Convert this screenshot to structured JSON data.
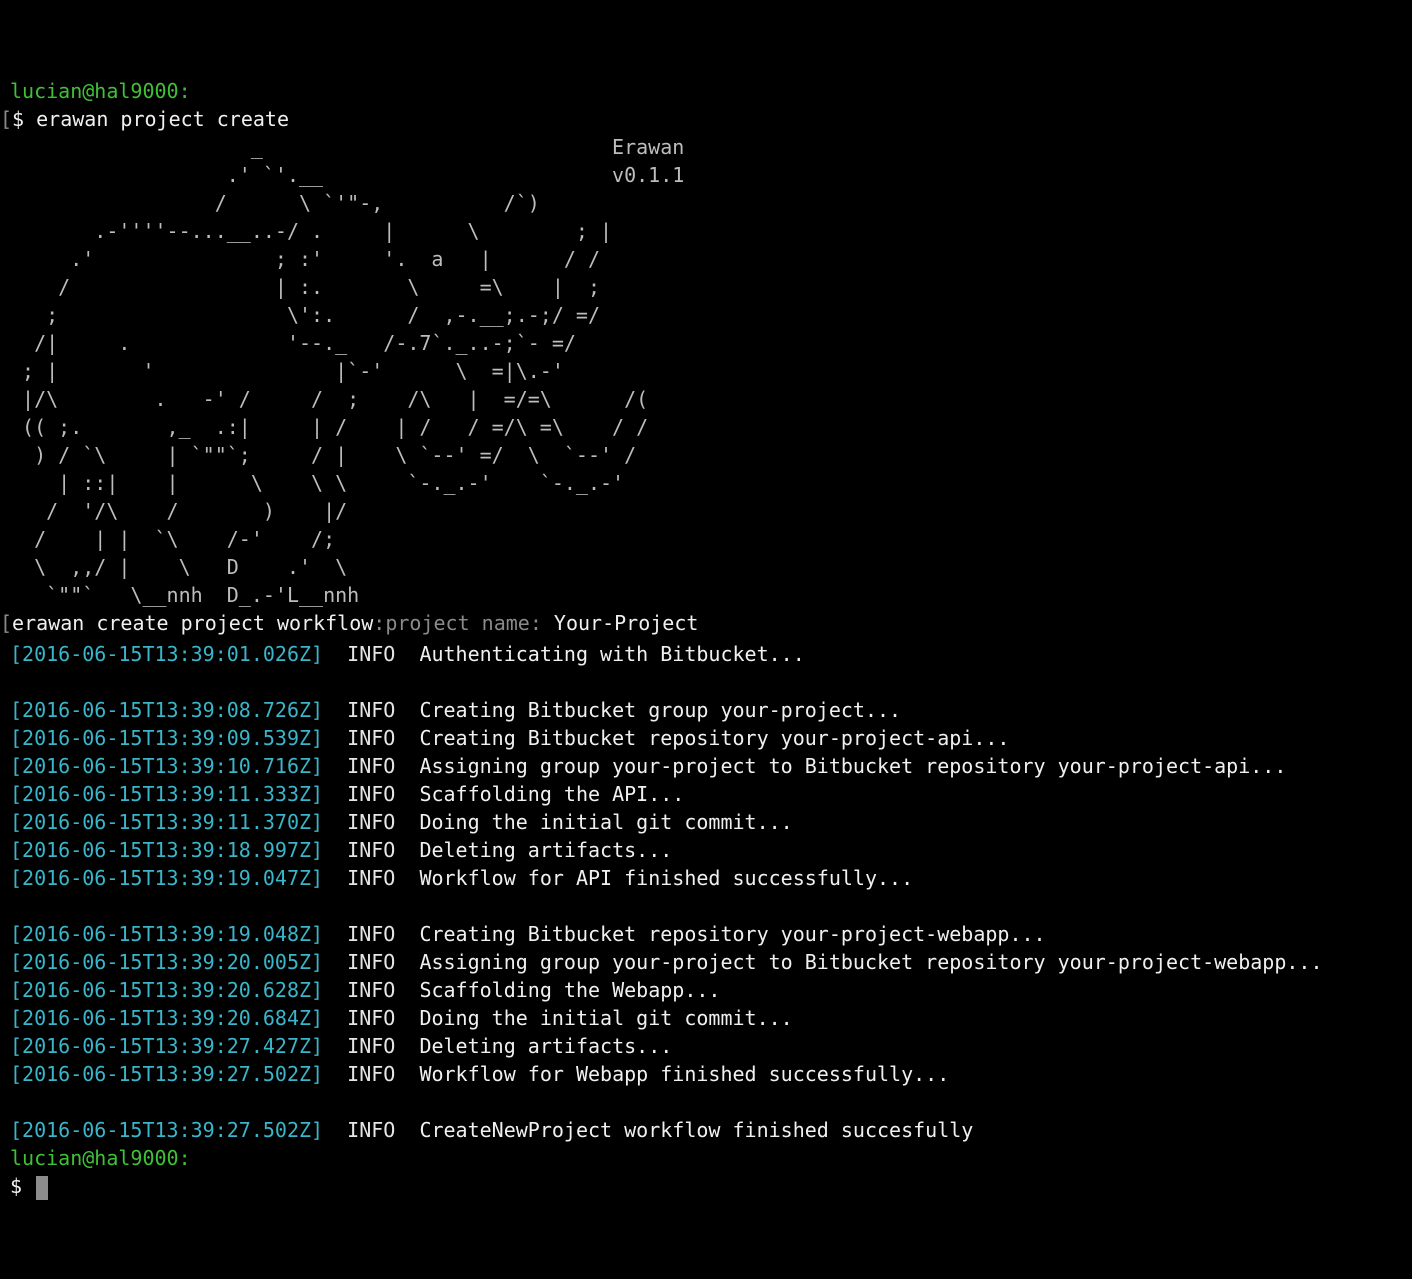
{
  "prompt1": {
    "user_host": "lucian@hal9000:",
    "bracket": "[",
    "symbol": "$ ",
    "command": "erawan project create"
  },
  "art": {
    "lines": [
      "                    _                             Erawan",
      "                  .' `'.__                        v0.1.1",
      "                 /      \\ `'\"-,          /`)",
      "       .-''''--...__..-/ .     |      \\        ; |",
      "     .'               ; :'     '.  a   |      / /",
      "    /                 | :.       \\     =\\    |  ;",
      "   ;                   \\':.      /  ,-.__;.-;/ =/",
      "  /|     .             '--._   /-.7`._..-;`- =/",
      " ; |       '               |`-'      \\  =|\\.-'",
      " |/\\        .   -' /     /  ;    /\\   |  =/=\\      /(",
      " (( ;.       ,_  .:|     | /    | /   / =/\\ =\\    / /",
      "  ) / `\\     | `\"\"`;     / |    \\ `--' =/  \\  `--' /",
      "    | ::|    |      \\    \\ \\     `-._.-'    `-._.-'",
      "   /  '/\\    /       )    |/",
      "  /    | |  `\\    /-'    /;",
      "  \\  ,,/ |    \\   D    .'  \\",
      "   `\"\"`   \\__nnh  D_.-'L__nnh"
    ]
  },
  "workflow_prompt": {
    "bracket": "[",
    "label": "erawan create project workflow",
    "colon": ":",
    "question": "project name: ",
    "answer": "Your-Project"
  },
  "logs": [
    {
      "ts": "[2016-06-15T13:39:01.026Z]",
      "level": "INFO",
      "msg": "Authenticating with Bitbucket..."
    },
    null,
    {
      "ts": "[2016-06-15T13:39:08.726Z]",
      "level": "INFO",
      "msg": "Creating Bitbucket group your-project..."
    },
    {
      "ts": "[2016-06-15T13:39:09.539Z]",
      "level": "INFO",
      "msg": "Creating Bitbucket repository your-project-api..."
    },
    {
      "ts": "[2016-06-15T13:39:10.716Z]",
      "level": "INFO",
      "msg": "Assigning group your-project to Bitbucket repository your-project-api..."
    },
    {
      "ts": "[2016-06-15T13:39:11.333Z]",
      "level": "INFO",
      "msg": "Scaffolding the API..."
    },
    {
      "ts": "[2016-06-15T13:39:11.370Z]",
      "level": "INFO",
      "msg": "Doing the initial git commit..."
    },
    {
      "ts": "[2016-06-15T13:39:18.997Z]",
      "level": "INFO",
      "msg": "Deleting artifacts..."
    },
    {
      "ts": "[2016-06-15T13:39:19.047Z]",
      "level": "INFO",
      "msg": "Workflow for API finished successfully..."
    },
    null,
    {
      "ts": "[2016-06-15T13:39:19.048Z]",
      "level": "INFO",
      "msg": "Creating Bitbucket repository your-project-webapp..."
    },
    {
      "ts": "[2016-06-15T13:39:20.005Z]",
      "level": "INFO",
      "msg": "Assigning group your-project to Bitbucket repository your-project-webapp..."
    },
    {
      "ts": "[2016-06-15T13:39:20.628Z]",
      "level": "INFO",
      "msg": "Scaffolding the Webapp..."
    },
    {
      "ts": "[2016-06-15T13:39:20.684Z]",
      "level": "INFO",
      "msg": "Doing the initial git commit..."
    },
    {
      "ts": "[2016-06-15T13:39:27.427Z]",
      "level": "INFO",
      "msg": "Deleting artifacts..."
    },
    {
      "ts": "[2016-06-15T13:39:27.502Z]",
      "level": "INFO",
      "msg": "Workflow for Webapp finished successfully..."
    },
    null,
    {
      "ts": "[2016-06-15T13:39:27.502Z]",
      "level": "INFO",
      "msg": "CreateNewProject workflow finished succesfully"
    }
  ],
  "prompt2": {
    "user_host": "lucian@hal9000:",
    "symbol": "$ "
  },
  "colors": {
    "background": "#000000",
    "prompt": "#3fc136",
    "timestamp": "#3ab5c9",
    "text": "#f0f0f0",
    "art": "#bdbdbd",
    "cursor": "#8c8c8c"
  }
}
